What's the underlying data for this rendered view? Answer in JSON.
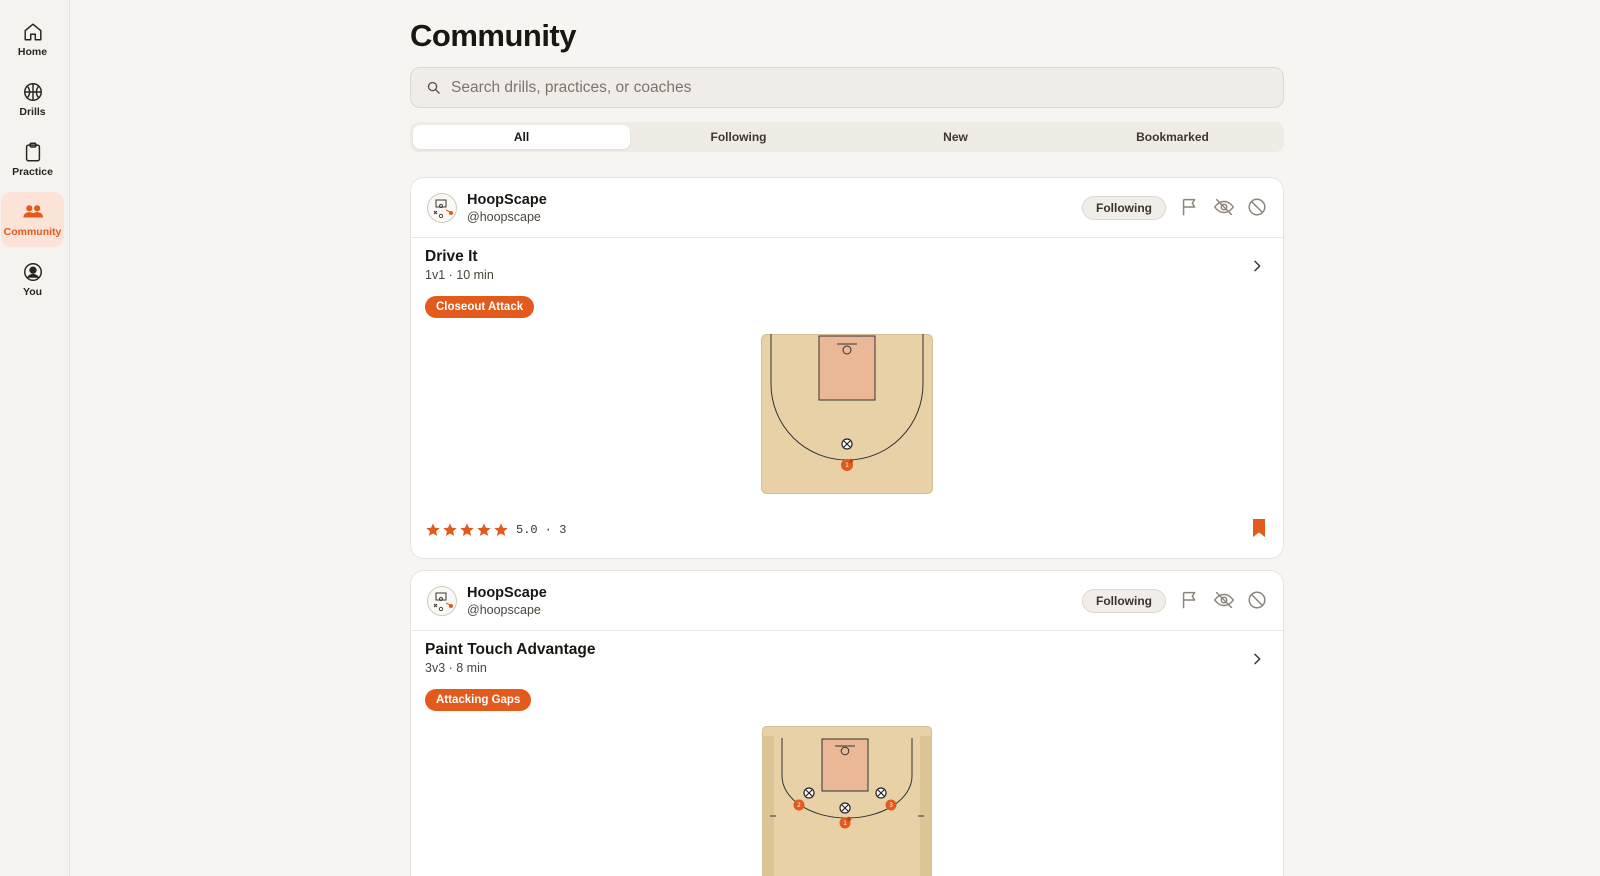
{
  "nav": {
    "items": [
      {
        "label": "Home",
        "icon": "home-icon"
      },
      {
        "label": "Drills",
        "icon": "basketball-icon"
      },
      {
        "label": "Practice",
        "icon": "clipboard-icon"
      },
      {
        "label": "Community",
        "icon": "users-icon",
        "active": true
      },
      {
        "label": "You",
        "icon": "user-circle-icon"
      }
    ]
  },
  "page": {
    "title": "Community"
  },
  "search": {
    "placeholder": "Search drills, practices, or coaches"
  },
  "tabs": [
    "All",
    "Following",
    "New",
    "Bookmarked"
  ],
  "active_tab": "All",
  "colors": {
    "accent": "#e25a1c",
    "court": "#e8d1a6",
    "paint": "#eab896",
    "background": "#f7f5f1"
  },
  "posts": [
    {
      "author": {
        "name": "HoopScape",
        "handle": "@hoopscape"
      },
      "follow_label": "Following",
      "drill": {
        "title": "Drive It",
        "meta": "1v1 · 10 min",
        "tag": "Closeout Attack"
      },
      "rating": {
        "stars": 5,
        "text": "5.0 · 3"
      },
      "bookmarked": true
    },
    {
      "author": {
        "name": "HoopScape",
        "handle": "@hoopscape"
      },
      "follow_label": "Following",
      "drill": {
        "title": "Paint Touch Advantage",
        "meta": "3v3 · 8 min",
        "tag": "Attacking Gaps"
      },
      "bookmarked": false
    }
  ]
}
